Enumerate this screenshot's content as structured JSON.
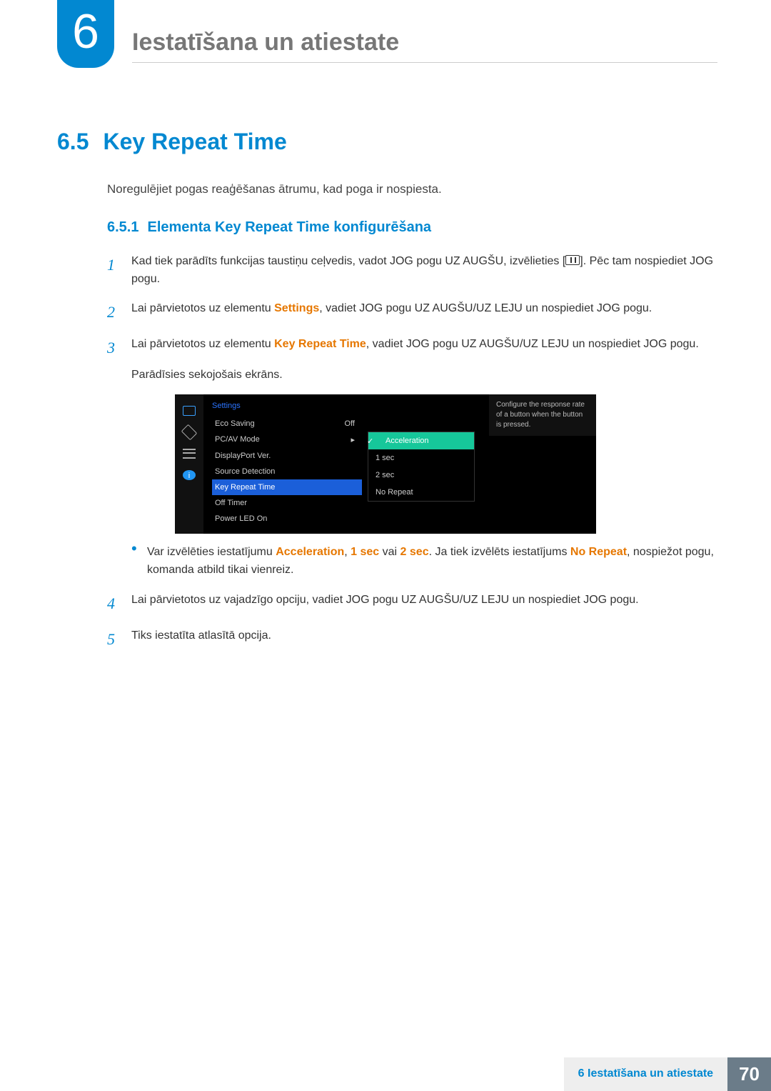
{
  "chapter": {
    "number": "6",
    "title": "Iestatīšana un atiestate"
  },
  "section": {
    "number": "6.5",
    "title": "Key Repeat Time"
  },
  "intro": "Noregulējiet pogas reaģēšanas ātrumu, kad poga ir nospiesta.",
  "subsection": {
    "number": "6.5.1",
    "title": "Elementa Key Repeat Time konfigurēšana"
  },
  "steps": {
    "s1a": "Kad tiek parādīts funkcijas taustiņu ceļvedis, vadot JOG pogu UZ AUGŠU, izvēlieties [",
    "s1b": "]. Pēc tam nospiediet JOG pogu.",
    "s2a": "Lai pārvietotos uz elementu ",
    "s2_settings": "Settings",
    "s2b": ", vadiet JOG pogu UZ AUGŠU/UZ LEJU un nospiediet JOG pogu.",
    "s3a": "Lai pārvietotos uz elementu ",
    "s3_kr": "Key Repeat Time",
    "s3b": ", vadiet JOG pogu UZ AUGŠU/UZ LEJU un nospiediet JOG pogu.",
    "s3c": "Parādīsies sekojošais ekrāns.",
    "bullet_a": "Var izvēlēties iestatījumu ",
    "opt_acc": "Acceleration",
    "comma1": ", ",
    "opt_1s": "1 sec",
    "or": " vai ",
    "opt_2s": "2 sec",
    "bullet_b": ". Ja tiek izvēlēts iestatījums ",
    "opt_nr": "No Repeat",
    "bullet_c": ", nospiežot pogu, komanda atbild tikai vienreiz.",
    "s4": "Lai pārvietotos uz vajadzīgo opciju, vadiet JOG pogu UZ AUGŠU/UZ LEJU un nospiediet JOG pogu.",
    "s5": "Tiks iestatīta atlasītā opcija.",
    "n1": "1",
    "n2": "2",
    "n3": "3",
    "n4": "4",
    "n5": "5"
  },
  "osd": {
    "title": "Settings",
    "items": [
      {
        "label": "Eco Saving",
        "value": "Off"
      },
      {
        "label": "PC/AV Mode",
        "value": "▸"
      },
      {
        "label": "DisplayPort Ver.",
        "value": ""
      },
      {
        "label": "Source Detection",
        "value": ""
      },
      {
        "label": "Key Repeat Time",
        "value": ""
      },
      {
        "label": "Off Timer",
        "value": ""
      },
      {
        "label": "Power LED On",
        "value": ""
      }
    ],
    "sub": [
      "Acceleration",
      "1 sec",
      "2 sec",
      "No Repeat"
    ],
    "help": "Configure the response rate of a button when the button is pressed.",
    "info_glyph": "i"
  },
  "footer": {
    "text": "6 Iestatīšana un atiestate",
    "page": "70"
  }
}
